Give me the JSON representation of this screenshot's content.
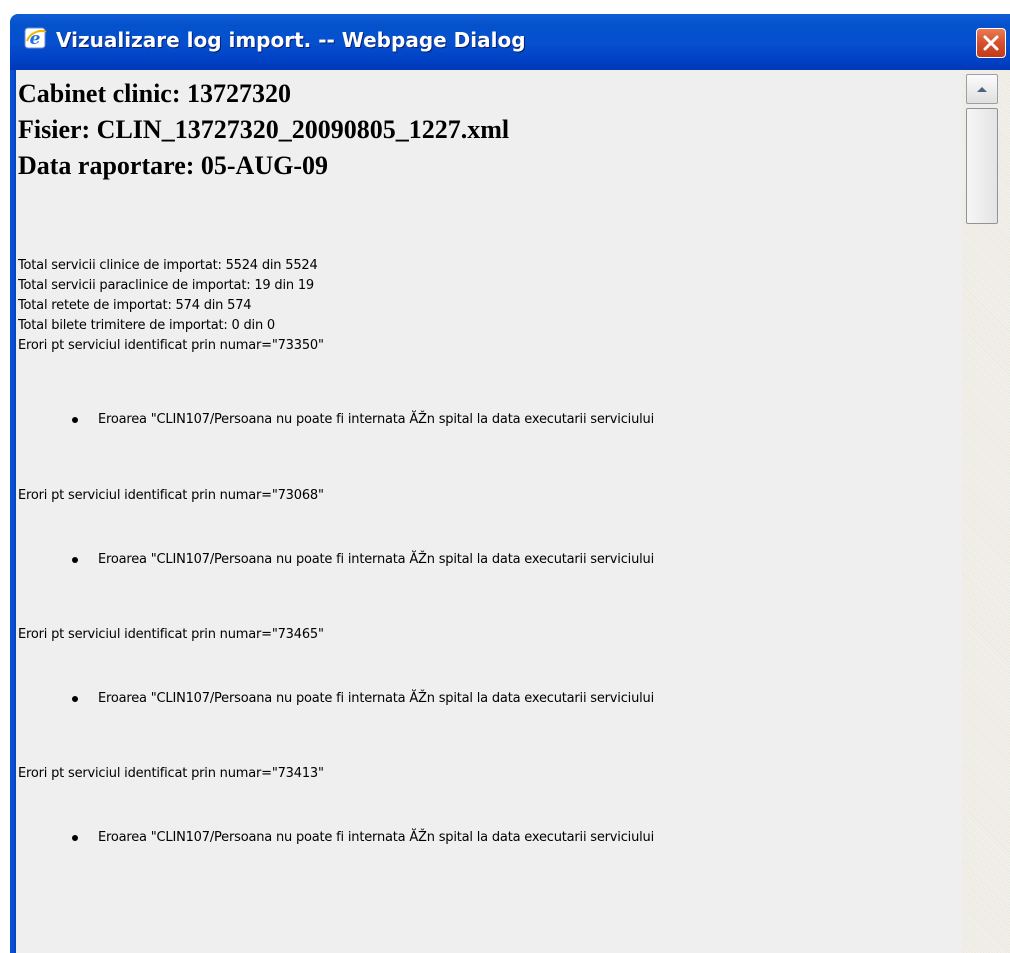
{
  "window": {
    "title": "Vizualizare log import. -- Webpage Dialog",
    "icon": "ie-icon",
    "accent_color": "#0a53d0",
    "close_color": "#d7502c"
  },
  "header": {
    "cabinet": "Cabinet clinic: 13727320",
    "fisier": "Fisier: CLIN_13727320_20090805_1227.xml",
    "data": "Data raportare: 05-AUG-09"
  },
  "totals": [
    "Total servicii clinice de importat: 5524 din 5524",
    "Total servicii paraclinice de importat: 19 din 19",
    "Total retete de importat: 574 din 574",
    "Total bilete trimitere de importat: 0 din 0"
  ],
  "errors": [
    {
      "heading": "Erori pt serviciul identificat prin numar=\"73350\"",
      "item": "Eroarea \"CLIN107/Persoana nu poate fi internata ĂŽn spital la data executarii serviciului"
    },
    {
      "heading": "Erori pt serviciul identificat prin numar=\"73068\"",
      "item": "Eroarea \"CLIN107/Persoana nu poate fi internata ĂŽn spital la data executarii serviciului"
    },
    {
      "heading": "Erori pt serviciul identificat prin numar=\"73465\"",
      "item": "Eroarea \"CLIN107/Persoana nu poate fi internata ĂŽn spital la data executarii serviciului"
    },
    {
      "heading": "Erori pt serviciul identificat prin numar=\"73413\"",
      "item": "Eroarea \"CLIN107/Persoana nu poate fi internata ĂŽn spital la data executarii serviciului"
    }
  ],
  "scrollbar": {
    "up_icon": "arrow-up-icon"
  }
}
